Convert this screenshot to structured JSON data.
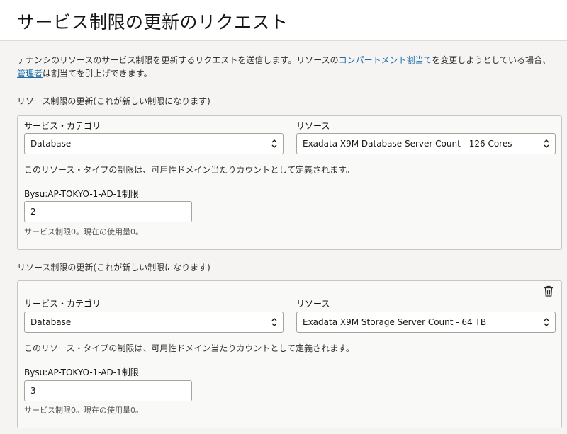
{
  "header": {
    "title": "サービス制限の更新のリクエスト"
  },
  "description": {
    "part1": "テナンシのリソースのサービス制限を更新するリクエストを送信します。リソースの",
    "link1": "コンパートメント割当て",
    "part2": "を変更しようとしている場合、",
    "link2": "管理者",
    "part3": "は割当てを引上げできます。"
  },
  "requests": [
    {
      "section_label": "リソース制限の更新(これが新しい制限になります)",
      "category_label": "サービス・カテゴリ",
      "category_value": "Database",
      "resource_label": "リソース",
      "resource_value": "Exadata X9M Database Server Count - 126 Cores",
      "scope_note": "このリソース・タイプの制限は、可用性ドメイン当たりカウントとして定義されます。",
      "limit_label": "Bysu:AP-TOKYO-1-AD-1制限",
      "limit_value": "2",
      "usage_hint": "サービス制限0。現在の使用量0。"
    },
    {
      "section_label": "リソース制限の更新(これが新しい制限になります)",
      "category_label": "サービス・カテゴリ",
      "category_value": "Database",
      "resource_label": "リソース",
      "resource_value": "Exadata X9M Storage Server Count - 64 TB",
      "scope_note": "このリソース・タイプの制限は、可用性ドメイン当たりカウントとして定義されます。",
      "limit_label": "Bysu:AP-TOKYO-1-AD-1制限",
      "limit_value": "3",
      "usage_hint": "サービス制限0。現在の使用量0。",
      "delete_icon": "trash-icon"
    }
  ]
}
